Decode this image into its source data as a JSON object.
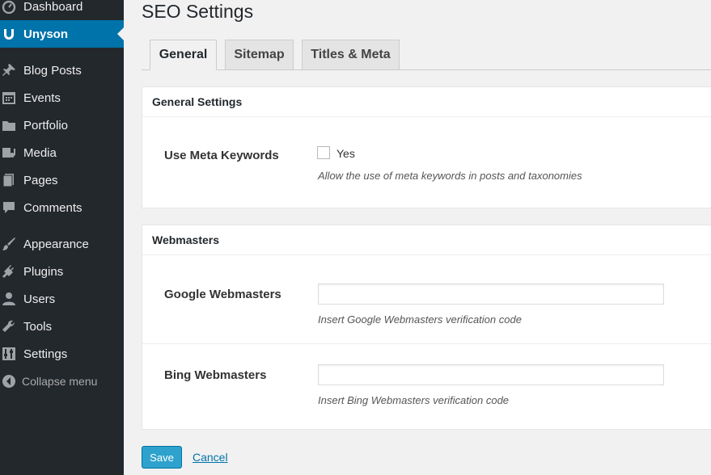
{
  "sidebar": {
    "items": [
      {
        "label": "Dashboard",
        "icon": "dashboard-icon"
      },
      {
        "label": "Unyson",
        "icon": "unyson-icon",
        "current": true
      },
      {
        "label": "Blog Posts",
        "icon": "pin-icon"
      },
      {
        "label": "Events",
        "icon": "calendar-icon"
      },
      {
        "label": "Portfolio",
        "icon": "folder-icon"
      },
      {
        "label": "Media",
        "icon": "media-icon"
      },
      {
        "label": "Pages",
        "icon": "pages-icon"
      },
      {
        "label": "Comments",
        "icon": "comment-icon"
      },
      {
        "label": "Appearance",
        "icon": "brush-icon"
      },
      {
        "label": "Plugins",
        "icon": "plug-icon"
      },
      {
        "label": "Users",
        "icon": "user-icon"
      },
      {
        "label": "Tools",
        "icon": "wrench-icon"
      },
      {
        "label": "Settings",
        "icon": "settings-icon"
      }
    ],
    "collapse_label": "Collapse menu"
  },
  "page": {
    "title": "SEO Settings",
    "tabs": [
      {
        "label": "General",
        "active": true
      },
      {
        "label": "Sitemap"
      },
      {
        "label": "Titles & Meta"
      }
    ]
  },
  "general_settings": {
    "header": "General Settings",
    "meta_keywords": {
      "label": "Use Meta Keywords",
      "checkbox_label": "Yes",
      "checked": false,
      "description": "Allow the use of meta keywords in posts and taxonomies"
    }
  },
  "webmasters": {
    "header": "Webmasters",
    "google": {
      "label": "Google Webmasters",
      "value": "",
      "description": "Insert Google Webmasters verification code"
    },
    "bing": {
      "label": "Bing Webmasters",
      "value": "",
      "description": "Insert Bing Webmasters verification code"
    }
  },
  "actions": {
    "save_label": "Save",
    "cancel_label": "Cancel"
  },
  "colors": {
    "sidebar_bg": "#23282d",
    "accent": "#0073aa",
    "button": "#2ea2cc"
  }
}
